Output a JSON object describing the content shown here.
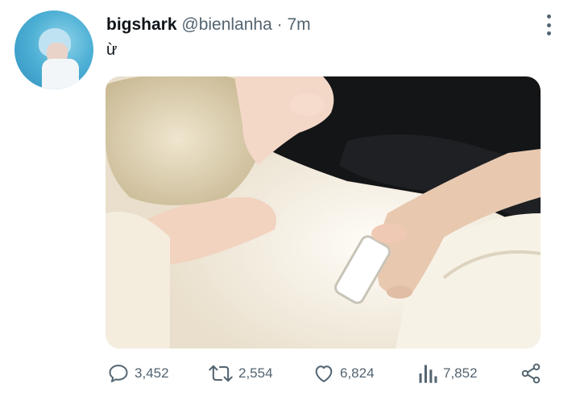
{
  "tweet": {
    "display_name": "bigshark",
    "handle": "@bienlanha",
    "separator": "·",
    "time": "7m",
    "text": "ừ"
  },
  "actions": {
    "replies": "3,452",
    "retweets": "2,554",
    "likes": "6,824",
    "views": "7,852"
  },
  "icons": {
    "reply": "reply-icon",
    "retweet": "retweet-icon",
    "like": "heart-icon",
    "views": "bar-chart-icon",
    "share": "share-icon",
    "more": "more-vertical-icon"
  },
  "colors": {
    "text": "#0f1419",
    "secondary": "#536471"
  }
}
